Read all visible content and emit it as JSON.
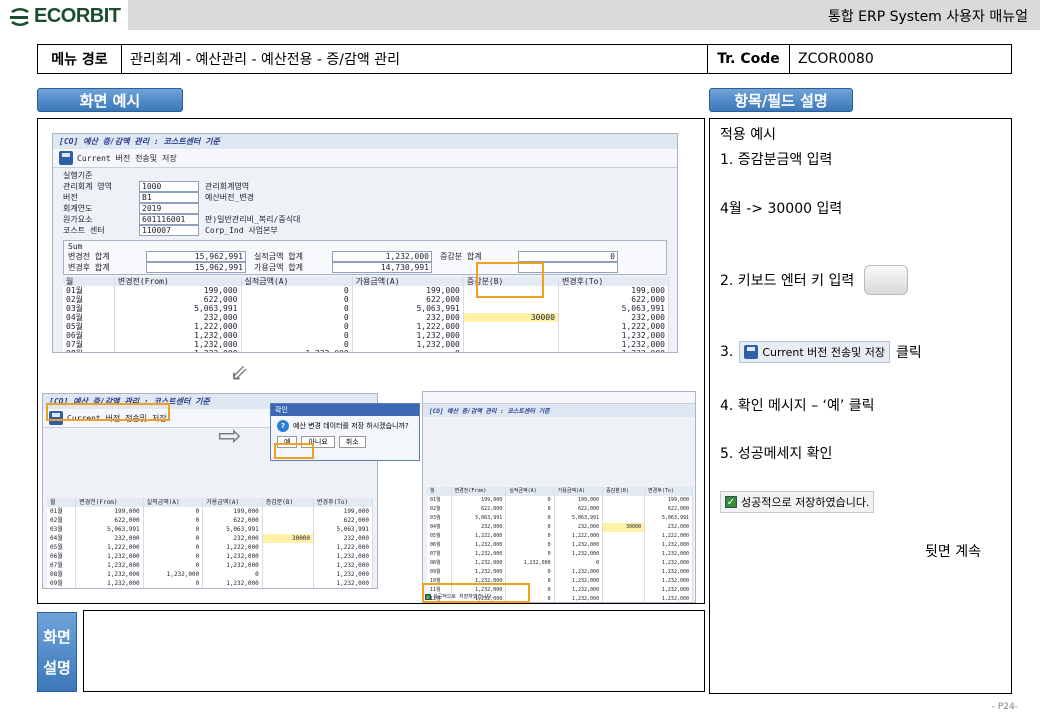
{
  "header": {
    "logo_text": "ECORBIT",
    "doc_title": "통합 ERP System 사용자 매뉴얼"
  },
  "menu_path": {
    "label": "메뉴 경로",
    "path": "관리회계 - 예산관리 - 예산전용 - 증/감액 관리",
    "tr_label": "Tr. Code",
    "tr_code": "ZCOR0080"
  },
  "sections": {
    "screen_example": "화면 예시",
    "field_desc": "항목/필드 설명",
    "note_label_1": "화면",
    "note_label_2": "설명"
  },
  "sap_main": {
    "title": "[CO] 예산 증/감액 관리 : 코스트센터 기준",
    "save_button": "Current 버전 전송및 저장",
    "criteria_title": "실행기준",
    "fields": [
      {
        "label": "관리회계 영역",
        "value": "1000",
        "desc": "관리회계영역"
      },
      {
        "label": "버전",
        "value": "B1",
        "desc": "예산버전_변경"
      },
      {
        "label": "회계연도",
        "value": "2019",
        "desc": ""
      },
      {
        "label": "원가요소",
        "value": "601116001",
        "desc": "판)일반관리비_복리/중식대"
      },
      {
        "label": "코스트 센터",
        "value": "110007",
        "desc": "Corp_Ind 사업본부"
      }
    ],
    "sum_title": "Sum",
    "sum_rows": [
      {
        "label1": "변경전 합계",
        "val1": "15,962,991",
        "label2": "실적금액 합계",
        "val2": "1,232,000",
        "label3": "증감분 합계",
        "val3": "0"
      },
      {
        "label1": "변경후 합계",
        "val1": "15,962,991",
        "label2": "가용금액 합계",
        "val2": "14,730,991",
        "label3": "",
        "val3": ""
      }
    ],
    "columns": [
      "월",
      "변경전(From)",
      "실적금액(A)",
      "가용금액(A)",
      "증감분(B)",
      "변경후(To)"
    ],
    "rows": [
      [
        "01월",
        "199,000",
        "0",
        "199,000",
        "",
        "199,000"
      ],
      [
        "02월",
        "622,000",
        "0",
        "622,000",
        "",
        "622,000"
      ],
      [
        "03월",
        "5,063,991",
        "0",
        "5,063,991",
        "",
        "5,063,991"
      ],
      [
        "04월",
        "232,000",
        "0",
        "232,000",
        "30000",
        "232,000"
      ],
      [
        "05월",
        "1,222,000",
        "0",
        "1,222,000",
        "",
        "1,222,000"
      ],
      [
        "06월",
        "1,232,000",
        "0",
        "1,232,000",
        "",
        "1,232,000"
      ],
      [
        "07월",
        "1,232,000",
        "0",
        "1,232,000",
        "",
        "1,232,000"
      ],
      [
        "08월",
        "1,232,000",
        "1,232,000",
        "0",
        "",
        "1,232,000"
      ],
      [
        "09월",
        "1,232,000",
        "0",
        "1,232,000",
        "",
        "1,232,000"
      ],
      [
        "10월",
        "1,232,000",
        "0",
        "1,232,000",
        "",
        "1,232,000"
      ],
      [
        "11월",
        "1,232,000",
        "0",
        "1,232,000",
        "",
        "1,232,000"
      ],
      [
        "12월",
        "1,232,000",
        "0",
        "1,232,000",
        "",
        "1,232,000"
      ]
    ]
  },
  "dialog": {
    "title": "확인",
    "message": "예산 변경 데이터를 저장 하시겠습니까?",
    "yes": "예",
    "no": "아니요",
    "cancel": "취소"
  },
  "sap_right": {
    "title": "[CO] 예산 증/감액 관리 : 코스트센터 기준",
    "status_msg": "성공적으로 저장하였습니다."
  },
  "description": {
    "heading": "적용 예시",
    "step1": "1. 증감분금액 입력",
    "step1_sub": "4월 -> 30000 입력",
    "step2": "2. 키보드 엔터 키 입력",
    "step3_prefix": "3.",
    "step3_button": "Current 버전 전송및 저장",
    "step3_suffix": "클릭",
    "step4": "4. 확인 메시지 – ‘예’ 클릭",
    "step5": "5. 성공메세지 확인",
    "success_msg": "성공적으로 저장하였습니다.",
    "continue": "뒷면 계속"
  },
  "footer": {
    "page": "- P24-"
  }
}
